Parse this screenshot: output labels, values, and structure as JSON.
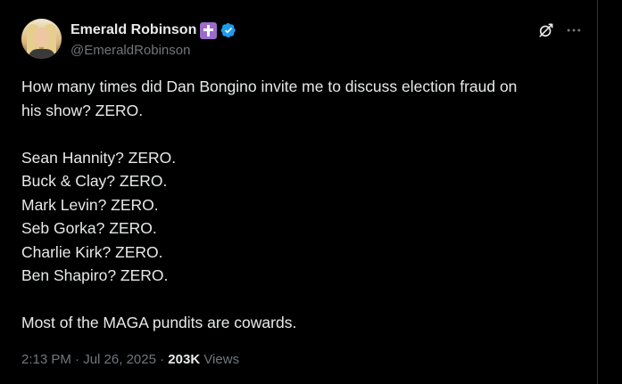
{
  "author": {
    "display_name": "Emerald Robinson",
    "handle": "@EmeraldRobinson",
    "badge_emoji": "cross-emoji",
    "verified": true,
    "verified_color": "#1d9bf0"
  },
  "tweet": {
    "lines": [
      "How many times did Dan Bongino invite me to discuss election fraud on",
      "his show? ZERO.",
      "",
      "Sean Hannity? ZERO.",
      "Buck & Clay? ZERO.",
      "Mark Levin? ZERO.",
      "Seb Gorka? ZERO.",
      "Charlie Kirk? ZERO.",
      "Ben Shapiro? ZERO.",
      "",
      "Most of the MAGA pundits are cowards."
    ]
  },
  "meta": {
    "time": "2:13 PM",
    "separator": "·",
    "date": "Jul 26, 2025",
    "views_count": "203K",
    "views_label": "Views"
  },
  "icons": {
    "grok": "grok-icon",
    "more": "more-icon"
  },
  "colors": {
    "background": "#000000",
    "text": "#e7e9ea",
    "secondary": "#71767b",
    "divider": "#2f3336",
    "cross_badge": "#9b6cc9"
  }
}
